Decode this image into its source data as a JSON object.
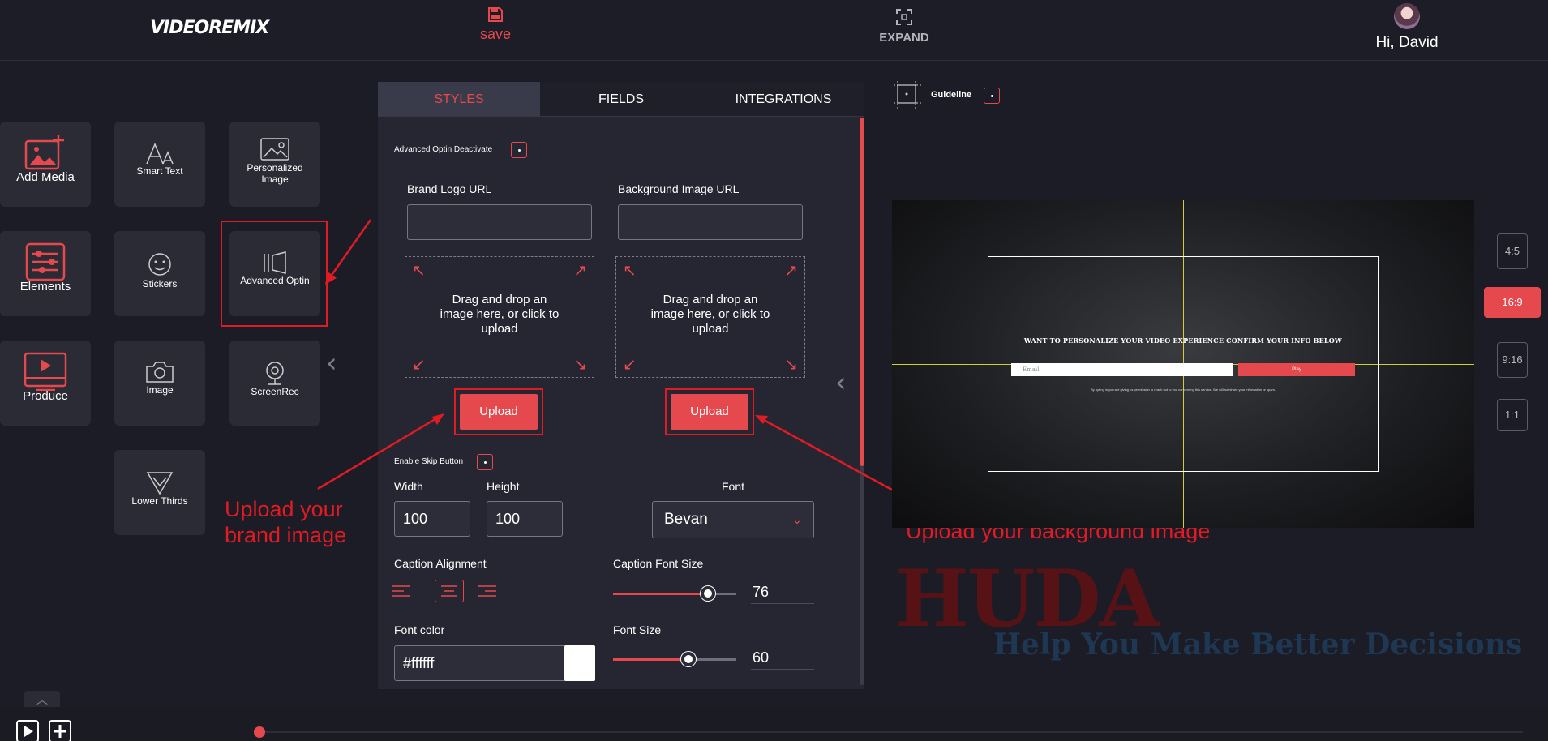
{
  "header": {
    "logo": {
      "part1": "VIDEORE",
      "part2": "MIX"
    },
    "save_label": "save",
    "expand_label": "EXPAND",
    "greeting": "Hi, David"
  },
  "sidebar": {
    "main_items": [
      {
        "label": "Add Media"
      },
      {
        "label": "Elements"
      },
      {
        "label": "Produce"
      }
    ],
    "tiles": [
      {
        "label": "Smart Text"
      },
      {
        "label": "Personalized Image"
      },
      {
        "label": "Stickers"
      },
      {
        "label": "Advanced Optin"
      },
      {
        "label": "Image"
      },
      {
        "label": "ScreenRec"
      },
      {
        "label": "Lower Thirds"
      }
    ]
  },
  "panel": {
    "tabs": [
      {
        "label": "STYLES",
        "active": true
      },
      {
        "label": "FIELDS",
        "active": false
      },
      {
        "label": "INTEGRATIONS",
        "active": false
      }
    ],
    "deactivate_label": "Advanced Optin Deactivate",
    "brand_logo_label": "Brand Logo URL",
    "brand_logo_value": "",
    "bg_image_label": "Background Image URL",
    "bg_image_value": "",
    "drop_text": "Drag and drop an image here, or click to upload",
    "upload_label": "Upload",
    "skip_label": "Enable Skip Button",
    "width_label": "Width",
    "width_value": "100",
    "height_label": "Height",
    "height_value": "100",
    "font_label": "Font",
    "font_value": "Bevan",
    "caption_align_label": "Caption Alignment",
    "caption_font_size_label": "Caption Font Size",
    "caption_font_size_value": "76",
    "font_color_label": "Font color",
    "font_color_value": "#ffffff",
    "font_size_label": "Font Size",
    "font_size_value": "60"
  },
  "annotations": {
    "brand": "Upload your brand image",
    "background": "Upload your background image"
  },
  "preview": {
    "guideline_label": "Guideline",
    "title": "WANT TO PERSONALIZE YOUR VIDEO EXPERIENCE CONFIRM YOUR INFO BELOW",
    "email_placeholder": "Email",
    "play_label": "Play",
    "note": "By opting in you are giving us permission to reach out to you concerning this service. We will not share your information or spam."
  },
  "ratios": [
    "4:5",
    "16:9",
    "9:16",
    "1:1"
  ],
  "active_ratio": "16:9",
  "watermark": {
    "title": "HUDA",
    "tagline": "Help You Make Better Decisions"
  },
  "colors": {
    "accent": "#e5484d",
    "background": "#1b1c25",
    "panel": "#2a2b36",
    "annotation": "#e01b24"
  }
}
